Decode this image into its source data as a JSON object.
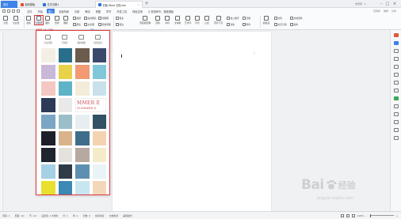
{
  "titlebar": {
    "tabs": [
      {
        "label": "首页",
        "color": "#3c82e8"
      },
      {
        "label": "稻壳模板",
        "color": "#e64b2e"
      },
      {
        "label": "文字文稿1",
        "color": "#2b6fd6"
      },
      {
        "label": "封面 Word 文档.doc",
        "color": "#2b6fd6"
      }
    ],
    "add_tab": "+",
    "right_status": "未登录 · 1"
  },
  "menubar": {
    "items": [
      "文件",
      "开始",
      "插入",
      "页面布局",
      "引用",
      "审阅",
      "视图",
      "章节",
      "开发工具",
      "特色应用",
      "Q 查找命令、搜索模板"
    ],
    "active_index": 2,
    "right": [
      "已同步",
      "协作",
      "分享"
    ]
  },
  "ribbon": {
    "buttons": [
      "分页",
      "空白页",
      "封面页",
      "表格",
      "图片",
      "形状",
      "图标",
      "截屏",
      "在线图表",
      "流程图",
      "思维导图",
      "更多",
      "页眉和页脚",
      "页码",
      "水印",
      "文本框",
      "艺术字",
      "符号",
      "公式",
      "首字下沉",
      "插入数字",
      "对象",
      "日期",
      "附件",
      "超链接",
      "书签",
      "交叉引用",
      "文档部件",
      "窗体"
    ],
    "small": [
      "图表",
      "关系图",
      "批注",
      "页眉页脚",
      "对象"
    ]
  },
  "panel": {
    "tip": "封面页 (插入封面)",
    "more": "更多 >",
    "header_items": [
      "空白封面",
      "已购买",
      "我的收藏",
      "最近使用"
    ],
    "thumbnails": [
      "#f3efe4",
      "#2a6f8a",
      "#6b5c4e",
      "#3b4a6a",
      "#c9b8d8",
      "#e8d24a",
      "#f29a74",
      "#7fc7d9",
      "#f3c8c2",
      "#5fb3c6",
      "#f3ecd9",
      "#c8e1ea",
      "#2c3a57",
      "#e9e9e9",
      "#ffffff",
      "#ffffff",
      "#7aa6c4",
      "#9bbec9",
      "#e7eef2",
      "#315164",
      "#1d1f2a",
      "#d8b38c",
      "#3f6e8b",
      "#f3d3b1",
      "#20242e",
      "#e4e2dd",
      "#b8a9a0",
      "#f4ecc9",
      "#a6d0e4",
      "#2f3c48",
      "#5e8fb1",
      "#e9f4f7",
      "#e8df2f",
      "#3b89b4",
      "#c7e6ef",
      "#f3d7b9",
      "#f3b4c1",
      "#bfe4ef",
      "#e9a4b2",
      "#f1e4c8"
    ],
    "banner_text": "MMER E",
    "banner_sub": "SUMMER S"
  },
  "statusbar": {
    "items": [
      "页码: 1",
      "页面: 1/1",
      "节: 1/1",
      "设置值: 2.5厘米",
      "行: 1",
      "列: 1",
      "字数: 0",
      "拼写检查",
      "文档校对",
      "兼容模式"
    ],
    "zoom": "100%"
  },
  "watermark": {
    "brand": "Bai",
    "cn": "经验",
    "url": "jingyan.baidu.com"
  },
  "colors": {
    "accent": "#3c82e8",
    "highlight": "#e03b3b"
  }
}
